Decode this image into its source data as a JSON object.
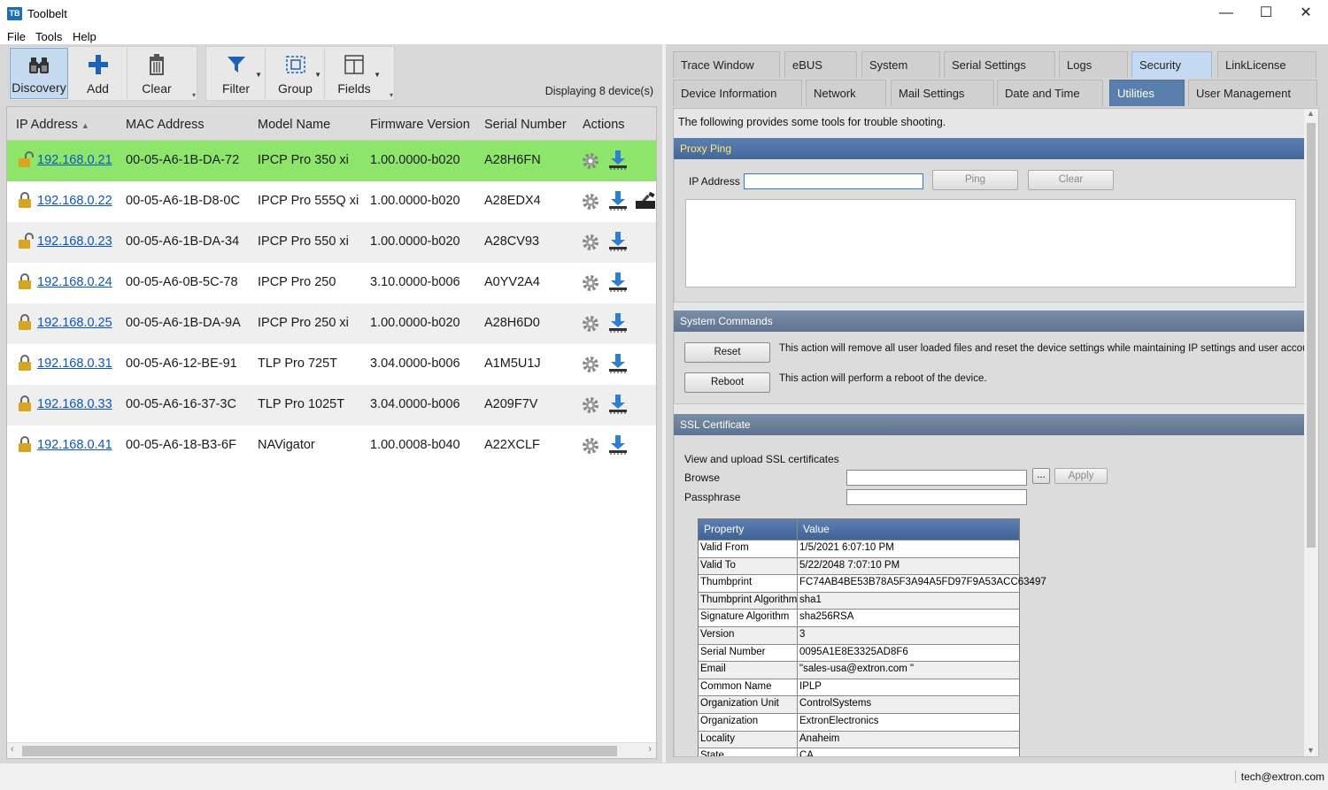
{
  "window": {
    "app_icon": "TB",
    "title": "Toolbelt",
    "minimize": "—",
    "maximize": "☐",
    "close": "✕"
  },
  "menu": [
    "File",
    "Tools",
    "Help"
  ],
  "toolbar": {
    "discovery": "Discovery",
    "add": "Add",
    "clear": "Clear",
    "filter": "Filter",
    "group": "Group",
    "fields": "Fields"
  },
  "device_count": "Displaying 8 device(s)",
  "grid": {
    "columns": [
      "IP Address",
      "MAC Address",
      "Model Name",
      "Firmware Version",
      "Serial Number",
      "Actions"
    ],
    "rows": [
      {
        "ip": "192.168.0.21",
        "mac": "00-05-A6-1B-DA-72",
        "model": "IPCP Pro 350 xi",
        "fw": "1.00.0000-b020",
        "serial": "A28H6FN",
        "lock": "unlocked",
        "extra": false
      },
      {
        "ip": "192.168.0.22",
        "mac": "00-05-A6-1B-D8-0C",
        "model": "IPCP Pro 555Q xi",
        "fw": "1.00.0000-b020",
        "serial": "A28EDX4",
        "lock": "locked",
        "extra": true
      },
      {
        "ip": "192.168.0.23",
        "mac": "00-05-A6-1B-DA-34",
        "model": "IPCP Pro 550 xi",
        "fw": "1.00.0000-b020",
        "serial": "A28CV93",
        "lock": "unlocked",
        "extra": false
      },
      {
        "ip": "192.168.0.24",
        "mac": "00-05-A6-0B-5C-78",
        "model": "IPCP Pro 250",
        "fw": "3.10.0000-b006",
        "serial": "A0YV2A4",
        "lock": "locked",
        "extra": false
      },
      {
        "ip": "192.168.0.25",
        "mac": "00-05-A6-1B-DA-9A",
        "model": "IPCP Pro 250 xi",
        "fw": "1.00.0000-b020",
        "serial": "A28H6D0",
        "lock": "locked",
        "extra": false
      },
      {
        "ip": "192.168.0.31",
        "mac": "00-05-A6-12-BE-91",
        "model": "TLP Pro 725T",
        "fw": "3.04.0000-b006",
        "serial": "A1M5U1J",
        "lock": "locked",
        "extra": false
      },
      {
        "ip": "192.168.0.33",
        "mac": "00-05-A6-16-37-3C",
        "model": "TLP Pro 1025T",
        "fw": "3.04.0000-b006",
        "serial": "A209F7V",
        "lock": "locked",
        "extra": false
      },
      {
        "ip": "192.168.0.41",
        "mac": "00-05-A6-18-B3-6F",
        "model": "NAVigator",
        "fw": "1.00.0008-b040",
        "serial": "A22XCLF",
        "lock": "locked",
        "extra": false
      }
    ]
  },
  "tabs_row1": [
    "Trace Window",
    "eBUS",
    "System",
    "Serial Settings",
    "Logs",
    "Security",
    "LinkLicense"
  ],
  "tabs_row2": [
    "Device Information",
    "Network",
    "Mail Settings",
    "Date and Time",
    "Utilities",
    "User Management"
  ],
  "intro": "The following provides some tools for trouble shooting.",
  "proxy_ping": {
    "header": "Proxy Ping",
    "ip_label": "IP Address",
    "ip_value": "",
    "ping": "Ping",
    "clear": "Clear"
  },
  "system_commands": {
    "header": "System Commands",
    "reset": "Reset",
    "reset_desc": "This action will remove all user loaded files and reset the device settings while maintaining IP settings and user accounts.",
    "reboot": "Reboot",
    "reboot_desc": "This action will perform a reboot of the device."
  },
  "ssl": {
    "header": "SSL Certificate",
    "intro": "View and upload SSL certificates",
    "browse_label": "Browse",
    "browse_btn": "...",
    "apply": "Apply",
    "passphrase_label": "Passphrase",
    "table_headers": [
      "Property",
      "Value"
    ],
    "table_rows": [
      [
        "Valid From",
        "1/5/2021 6:07:10 PM"
      ],
      [
        "Valid To",
        "5/22/2048 7:07:10 PM"
      ],
      [
        "Thumbprint",
        "FC74AB4BE53B78A5F3A94A5FD97F9A53ACC63497"
      ],
      [
        "Thumbprint Algorithm",
        "sha1"
      ],
      [
        "Signature Algorithm",
        "sha256RSA"
      ],
      [
        "Version",
        "3"
      ],
      [
        "Serial Number",
        "0095A1E8E3325AD8F6"
      ],
      [
        "Email",
        "\"sales-usa@extron.com \""
      ],
      [
        "Common Name",
        "IPLP"
      ],
      [
        "Organization Unit",
        "ControlSystems"
      ],
      [
        "Organization",
        "ExtronElectronics"
      ],
      [
        "Locality",
        "Anaheim"
      ],
      [
        "State",
        "CA"
      ]
    ]
  },
  "status_user": "tech@extron.com",
  "colors": {
    "selected_row": "#8de66a",
    "link": "#0b56c2",
    "selected_tab": "#5a7fae"
  }
}
